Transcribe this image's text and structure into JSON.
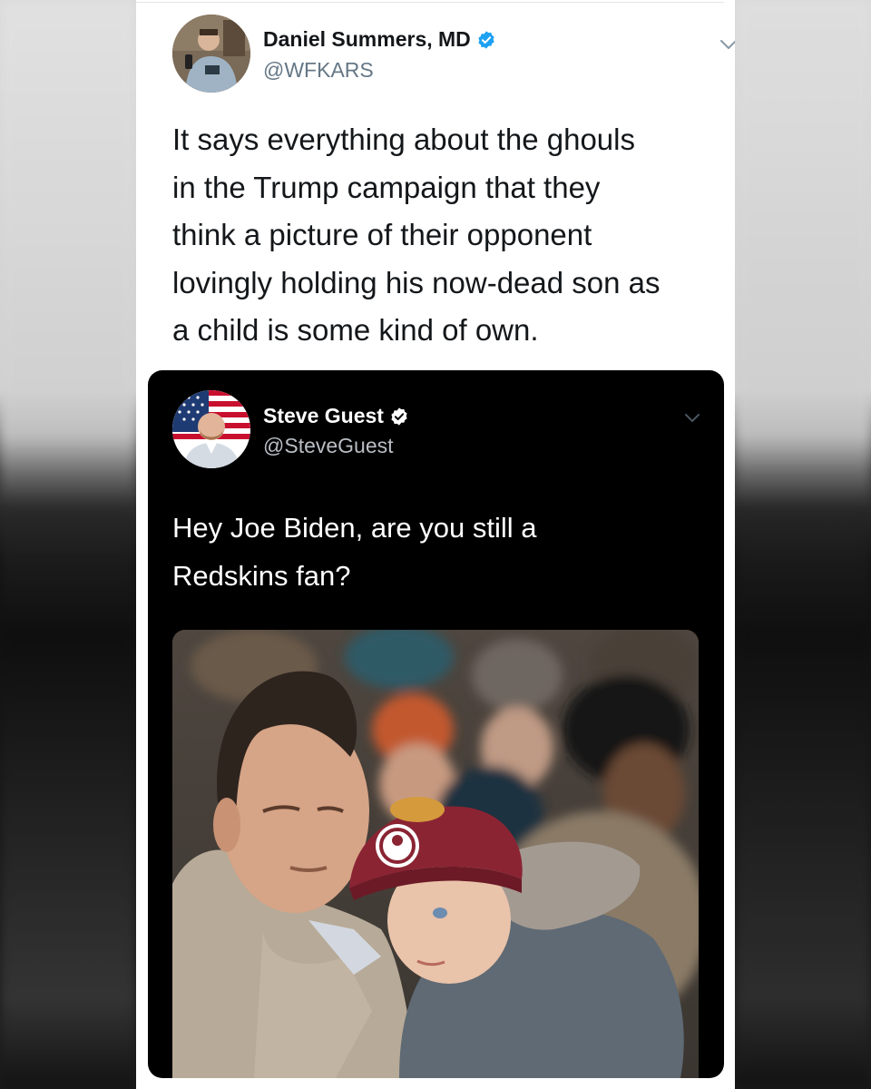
{
  "tweet": {
    "author_name": "Daniel Summers, MD",
    "author_handle": "@WFKARS",
    "verified": true,
    "text": "It says everything about the ghouls\nin the Trump campaign that they\nthink a picture of their opponent\nlovingly holding his now-dead son as\na child is some kind of own.",
    "menu_icon": "chevron-down-icon"
  },
  "quoted_tweet": {
    "author_name": "Steve Guest",
    "author_handle": "@SteveGuest",
    "verified": true,
    "text": "Hey Joe Biden, are you still a\nRedskins fan?",
    "menu_icon": "chevron-down-icon",
    "has_photo": true
  },
  "colors": {
    "verified_blue": "#1da1f2",
    "handle_gray": "#657786",
    "text_dark": "#14171a",
    "quote_bg": "#000000"
  }
}
